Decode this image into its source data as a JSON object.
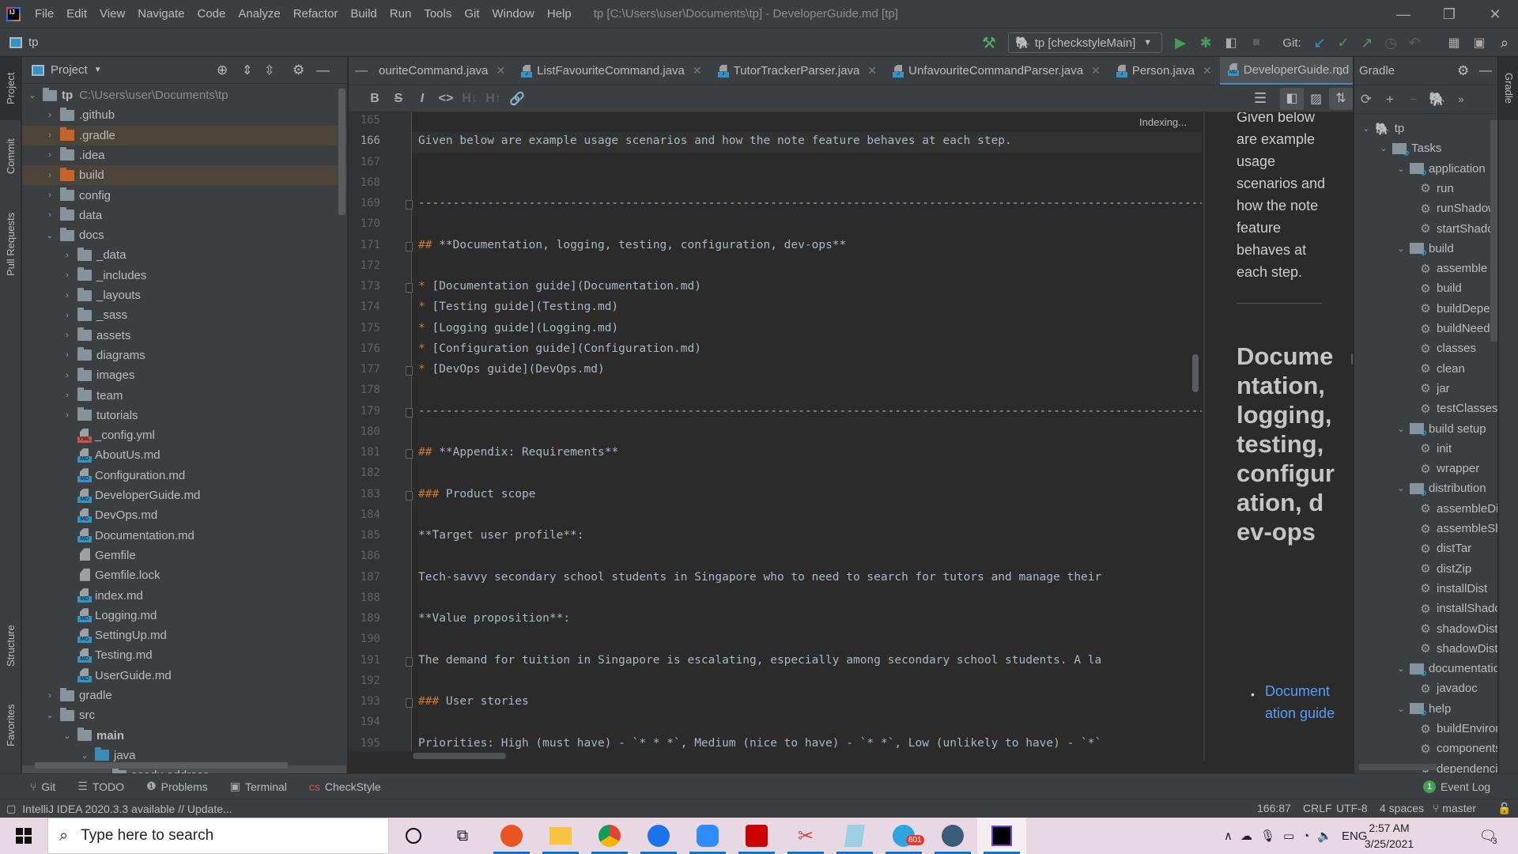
{
  "app": {
    "menu": [
      "File",
      "Edit",
      "View",
      "Navigate",
      "Code",
      "Analyze",
      "Refactor",
      "Build",
      "Run",
      "Tools",
      "Git",
      "Window",
      "Help"
    ],
    "window_title": "tp [C:\\Users\\user\\Documents\\tp] - DeveloperGuide.md [tp]",
    "window_controls": {
      "minimize": "—",
      "restore": "❐",
      "close": "✕"
    }
  },
  "navbar": {
    "project_name": "tp",
    "run_config": "tp [checkstyleMain]",
    "git_label": "Git:"
  },
  "left_stripe": {
    "tabs": [
      "Project",
      "Commit",
      "Pull Requests",
      "Structure",
      "Favorites"
    ]
  },
  "project_panel": {
    "title": "Project",
    "root": {
      "name": "tp",
      "path": "C:\\Users\\user\\Documents\\tp"
    },
    "items": [
      {
        "name": ".github",
        "type": "folder",
        "depth": 1,
        "expanded": false
      },
      {
        "name": ".gradle",
        "type": "folder-excluded",
        "depth": 1,
        "expanded": false
      },
      {
        "name": ".idea",
        "type": "folder",
        "depth": 1,
        "expanded": false
      },
      {
        "name": "build",
        "type": "folder-excluded",
        "depth": 1,
        "expanded": false
      },
      {
        "name": "config",
        "type": "folder",
        "depth": 1,
        "expanded": false
      },
      {
        "name": "data",
        "type": "folder",
        "depth": 1,
        "expanded": false
      },
      {
        "name": "docs",
        "type": "folder",
        "depth": 1,
        "expanded": true
      },
      {
        "name": "_data",
        "type": "folder",
        "depth": 2,
        "expanded": false
      },
      {
        "name": "_includes",
        "type": "folder",
        "depth": 2,
        "expanded": false
      },
      {
        "name": "_layouts",
        "type": "folder",
        "depth": 2,
        "expanded": false
      },
      {
        "name": "_sass",
        "type": "folder",
        "depth": 2,
        "expanded": false
      },
      {
        "name": "assets",
        "type": "folder",
        "depth": 2,
        "expanded": false
      },
      {
        "name": "diagrams",
        "type": "folder",
        "depth": 2,
        "expanded": false
      },
      {
        "name": "images",
        "type": "folder",
        "depth": 2,
        "expanded": false
      },
      {
        "name": "team",
        "type": "folder",
        "depth": 2,
        "expanded": false
      },
      {
        "name": "tutorials",
        "type": "folder",
        "depth": 2,
        "expanded": false
      },
      {
        "name": "_config.yml",
        "type": "yml",
        "depth": 2
      },
      {
        "name": "AboutUs.md",
        "type": "md",
        "depth": 2
      },
      {
        "name": "Configuration.md",
        "type": "md",
        "depth": 2
      },
      {
        "name": "DeveloperGuide.md",
        "type": "md",
        "depth": 2
      },
      {
        "name": "DevOps.md",
        "type": "md",
        "depth": 2
      },
      {
        "name": "Documentation.md",
        "type": "md",
        "depth": 2
      },
      {
        "name": "Gemfile",
        "type": "text",
        "depth": 2
      },
      {
        "name": "Gemfile.lock",
        "type": "text",
        "depth": 2
      },
      {
        "name": "index.md",
        "type": "md",
        "depth": 2
      },
      {
        "name": "Logging.md",
        "type": "md",
        "depth": 2
      },
      {
        "name": "SettingUp.md",
        "type": "md",
        "depth": 2
      },
      {
        "name": "Testing.md",
        "type": "md",
        "depth": 2
      },
      {
        "name": "UserGuide.md",
        "type": "md",
        "depth": 2
      },
      {
        "name": "gradle",
        "type": "folder",
        "depth": 1,
        "expanded": false
      },
      {
        "name": "src",
        "type": "folder",
        "depth": 1,
        "expanded": true
      },
      {
        "name": "main",
        "type": "module",
        "depth": 2,
        "expanded": true
      },
      {
        "name": "java",
        "type": "folder-src",
        "depth": 3,
        "expanded": true
      },
      {
        "name": "seedu.address",
        "type": "package",
        "depth": 4,
        "expanded": true
      }
    ]
  },
  "editor": {
    "tabs": [
      {
        "label": "ouriteCommand.java",
        "active": false
      },
      {
        "label": "ListFavouriteCommand.java",
        "active": false
      },
      {
        "label": "TutorTrackerParser.java",
        "active": false
      },
      {
        "label": "UnfavouriteCommandParser.java",
        "active": false
      },
      {
        "label": "Person.java",
        "active": false
      },
      {
        "label": "DeveloperGuide.md",
        "active": true
      }
    ],
    "md_toolbar": [
      "B",
      "S",
      "I",
      "<>",
      "H↓",
      "H↑",
      "link"
    ],
    "status_overlay": "Indexing...",
    "current_line": 166,
    "lines": [
      {
        "n": 165,
        "text": ""
      },
      {
        "n": 166,
        "text": "Given below are example usage scenarios and how the note feature behaves at each step."
      },
      {
        "n": 167,
        "text": ""
      },
      {
        "n": 168,
        "text": ""
      },
      {
        "n": 169,
        "text": "--------------------------------------------------------------------------------------------------------------------"
      },
      {
        "n": 170,
        "text": ""
      },
      {
        "n": 171,
        "marker": "##",
        "text": " **Documentation, logging, testing, configuration, dev-ops**"
      },
      {
        "n": 172,
        "text": ""
      },
      {
        "n": 173,
        "marker": "*",
        "text": " [Documentation guide](Documentation.md)"
      },
      {
        "n": 174,
        "marker": "*",
        "text": " [Testing guide](Testing.md)"
      },
      {
        "n": 175,
        "marker": "*",
        "text": " [Logging guide](Logging.md)"
      },
      {
        "n": 176,
        "marker": "*",
        "text": " [Configuration guide](Configuration.md)"
      },
      {
        "n": 177,
        "marker": "*",
        "text": " [DevOps guide](DevOps.md)"
      },
      {
        "n": 178,
        "text": ""
      },
      {
        "n": 179,
        "text": "--------------------------------------------------------------------------------------------------------------------"
      },
      {
        "n": 180,
        "text": ""
      },
      {
        "n": 181,
        "marker": "##",
        "text": " **Appendix: Requirements**"
      },
      {
        "n": 182,
        "text": ""
      },
      {
        "n": 183,
        "marker": "###",
        "text": " Product scope"
      },
      {
        "n": 184,
        "text": ""
      },
      {
        "n": 185,
        "text": "**Target user profile**:"
      },
      {
        "n": 186,
        "text": ""
      },
      {
        "n": 187,
        "text": "Tech-savvy secondary school students in Singapore who to need to search for tutors and manage their"
      },
      {
        "n": 188,
        "text": ""
      },
      {
        "n": 189,
        "text": "**Value proposition**:"
      },
      {
        "n": 190,
        "text": ""
      },
      {
        "n": 191,
        "text": "The demand for tuition in Singapore is escalating, especially among secondary school students. A la"
      },
      {
        "n": 192,
        "text": ""
      },
      {
        "n": 193,
        "marker": "###",
        "text": " User stories"
      },
      {
        "n": 194,
        "text": ""
      },
      {
        "n": 195,
        "text": "Priorities: High (must have) - `* * *`, Medium (nice to have) - `* *`, Low (unlikely to have) - `*`"
      }
    ]
  },
  "preview": {
    "paragraph": "Given below are example usage scenarios and how the note feature behaves at each step.",
    "heading": "Documentation, logging, testing, configuration, dev-ops",
    "first_link": "Documentation guide"
  },
  "gradle": {
    "title": "Gradle",
    "stripe_label": "Gradle",
    "tree": [
      {
        "name": "tp",
        "kind": "root",
        "depth": 0
      },
      {
        "name": "Tasks",
        "kind": "group",
        "depth": 1
      },
      {
        "name": "application",
        "kind": "group",
        "depth": 2
      },
      {
        "name": "run",
        "kind": "task",
        "depth": 3
      },
      {
        "name": "runShadow",
        "kind": "task",
        "depth": 3
      },
      {
        "name": "startShadowScripts",
        "kind": "task",
        "depth": 3
      },
      {
        "name": "build",
        "kind": "group",
        "depth": 2
      },
      {
        "name": "assemble",
        "kind": "task",
        "depth": 3
      },
      {
        "name": "build",
        "kind": "task",
        "depth": 3
      },
      {
        "name": "buildDependents",
        "kind": "task",
        "depth": 3
      },
      {
        "name": "buildNeeded",
        "kind": "task",
        "depth": 3
      },
      {
        "name": "classes",
        "kind": "task",
        "depth": 3
      },
      {
        "name": "clean",
        "kind": "task",
        "depth": 3
      },
      {
        "name": "jar",
        "kind": "task",
        "depth": 3
      },
      {
        "name": "testClasses",
        "kind": "task",
        "depth": 3
      },
      {
        "name": "build setup",
        "kind": "group",
        "depth": 2
      },
      {
        "name": "init",
        "kind": "task",
        "depth": 3
      },
      {
        "name": "wrapper",
        "kind": "task",
        "depth": 3
      },
      {
        "name": "distribution",
        "kind": "group",
        "depth": 2
      },
      {
        "name": "assembleDist",
        "kind": "task",
        "depth": 3
      },
      {
        "name": "assembleShadowDist",
        "kind": "task",
        "depth": 3
      },
      {
        "name": "distTar",
        "kind": "task",
        "depth": 3
      },
      {
        "name": "distZip",
        "kind": "task",
        "depth": 3
      },
      {
        "name": "installDist",
        "kind": "task",
        "depth": 3
      },
      {
        "name": "installShadowDist",
        "kind": "task",
        "depth": 3
      },
      {
        "name": "shadowDistTar",
        "kind": "task",
        "depth": 3
      },
      {
        "name": "shadowDistZip",
        "kind": "task",
        "depth": 3
      },
      {
        "name": "documentation",
        "kind": "group",
        "depth": 2
      },
      {
        "name": "javadoc",
        "kind": "task",
        "depth": 3
      },
      {
        "name": "help",
        "kind": "group",
        "depth": 2
      },
      {
        "name": "buildEnvironment",
        "kind": "task",
        "depth": 3
      },
      {
        "name": "components",
        "kind": "task",
        "depth": 3
      },
      {
        "name": "dependencies",
        "kind": "task",
        "depth": 3
      }
    ]
  },
  "bottom_tools": [
    "Git",
    "TODO",
    "Problems",
    "Terminal",
    "CheckStyle"
  ],
  "event_log": {
    "label": "Event Log",
    "count": "1"
  },
  "statusbar": {
    "message": "IntelliJ IDEA 2020.3.3 available // Update...",
    "position": "166:87",
    "line_ending": "CRLF",
    "encoding": "UTF-8",
    "indent": "4 spaces",
    "branch": "master"
  },
  "taskbar": {
    "search_placeholder": "Type here to search",
    "telegram_badge": "601",
    "language": "ENG",
    "time": "2:57 AM",
    "date": "3/25/2021",
    "notifications": "3"
  }
}
